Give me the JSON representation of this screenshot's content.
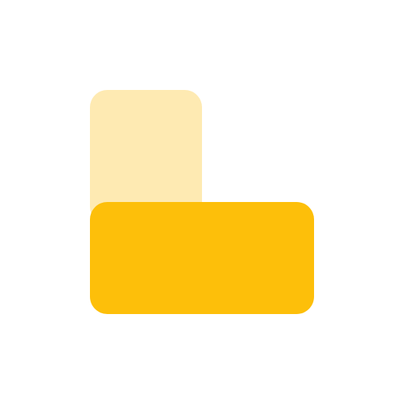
{
  "icon": {
    "name": "layout-icon",
    "colors": {
      "background": "#ffffff",
      "light_block": "#feeab2",
      "dark_block": "#fdbf0a"
    }
  }
}
